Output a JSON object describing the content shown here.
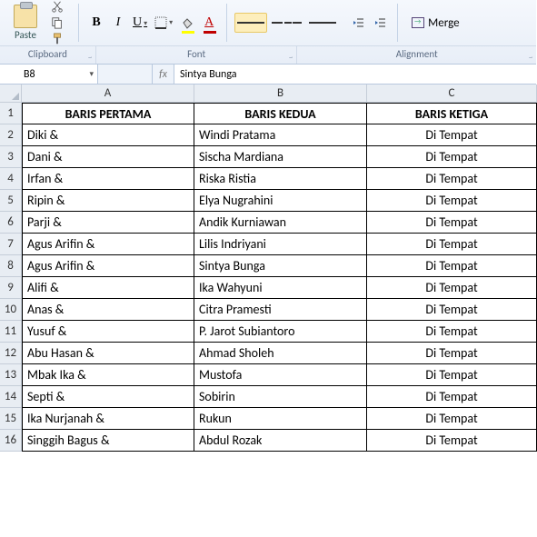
{
  "ribbon": {
    "paste": "Paste",
    "merge": "Merge",
    "groups": {
      "clipboard": "Clipboard",
      "font": "Font",
      "alignment": "Alignment"
    }
  },
  "namebox": "B8",
  "fx": "fx",
  "formula": "Sintya Bunga",
  "columns": [
    "A",
    "B",
    "C"
  ],
  "headers": [
    "BARIS PERTAMA",
    "BARIS KEDUA",
    "BARIS KETIGA"
  ],
  "rows": [
    {
      "n": 2,
      "a": "Diki &",
      "b": "Windi Pratama",
      "c": "Di Tempat"
    },
    {
      "n": 3,
      "a": "Dani &",
      "b": "Sischa Mardiana",
      "c": "Di Tempat"
    },
    {
      "n": 4,
      "a": "Irfan &",
      "b": "Riska Ristia",
      "c": "Di Tempat"
    },
    {
      "n": 5,
      "a": "Ripin &",
      "b": "Elya Nugrahini",
      "c": "Di Tempat"
    },
    {
      "n": 6,
      "a": "Parji &",
      "b": "Andik Kurniawan",
      "c": "Di Tempat"
    },
    {
      "n": 7,
      "a": "Agus Arifin &",
      "b": "Lilis Indriyani",
      "c": "Di Tempat"
    },
    {
      "n": 8,
      "a": "Agus Arifin &",
      "b": "Sintya Bunga",
      "c": "Di Tempat"
    },
    {
      "n": 9,
      "a": "Alifi &",
      "b": "Ika Wahyuni",
      "c": "Di Tempat"
    },
    {
      "n": 10,
      "a": "Anas &",
      "b": "Citra Pramesti",
      "c": "Di Tempat"
    },
    {
      "n": 11,
      "a": "Yusuf &",
      "b": "P. Jarot Subiantoro",
      "c": "Di Tempat"
    },
    {
      "n": 12,
      "a": "Abu Hasan &",
      "b": "Ahmad Sholeh",
      "c": "Di Tempat"
    },
    {
      "n": 13,
      "a": "Mbak Ika &",
      "b": "Mustofa",
      "c": "Di Tempat"
    },
    {
      "n": 14,
      "a": "Septi &",
      "b": "Sobirin",
      "c": "Di Tempat"
    },
    {
      "n": 15,
      "a": "Ika Nurjanah &",
      "b": "Rukun",
      "c": "Di Tempat"
    },
    {
      "n": 16,
      "a": "Singgih Bagus &",
      "b": "Abdul Rozak",
      "c": "Di Tempat"
    }
  ]
}
